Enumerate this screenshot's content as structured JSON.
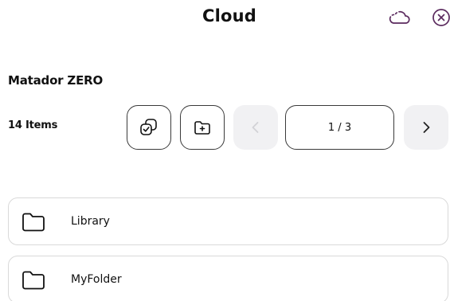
{
  "header": {
    "title": "Cloud",
    "cloud_icon": "cloud-icon",
    "close_icon": "close-icon"
  },
  "folder": {
    "name": "Matador ZERO",
    "item_count": "14 Items"
  },
  "toolbar": {
    "select_icon": "multi-select-icon",
    "new_folder_icon": "new-folder-icon",
    "prev_icon": "chevron-left-icon",
    "next_icon": "chevron-right-icon",
    "pagination": "1 / 3"
  },
  "items": [
    {
      "label": "Library",
      "icon": "folder-icon"
    },
    {
      "label": "MyFolder",
      "icon": "folder-icon"
    }
  ],
  "colors": {
    "accent": "#5b2a5e",
    "border": "#3a3a3a",
    "disabled_bg": "#f1f1f3"
  }
}
